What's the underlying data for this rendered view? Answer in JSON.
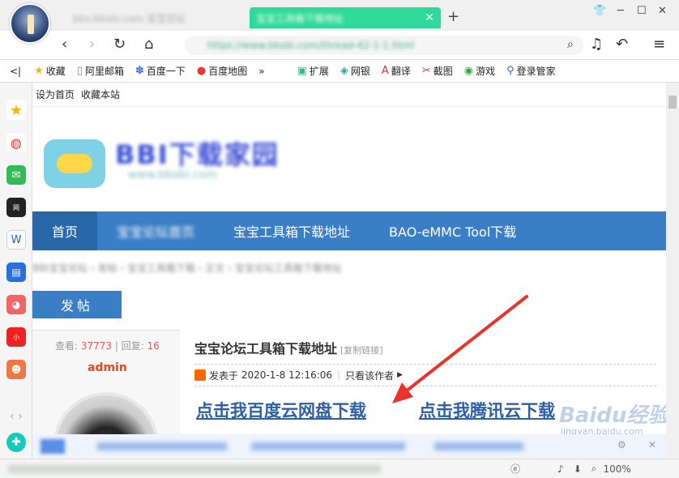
{
  "browser": {
    "tabs": [
      {
        "label": "bbs.bbsbi.com 宝宝论坛"
      },
      {
        "label": "宝宝工具箱下载地址"
      }
    ],
    "url": "https://www.bbsbi.com/thread-42-1-1.html",
    "new_tab": "+",
    "zoom": "100%"
  },
  "bookmarks": [
    {
      "label": "收藏",
      "icon": "star-icon"
    },
    {
      "label": "阿里邮箱",
      "icon": "page-icon"
    },
    {
      "label": "百度一下",
      "icon": "paw-icon"
    },
    {
      "label": "百度地图",
      "icon": "pin-icon"
    },
    {
      "label": "扩展",
      "icon": "puzzle-icon"
    },
    {
      "label": "网银",
      "icon": "shield-icon"
    },
    {
      "label": "翻译",
      "icon": "translate-icon"
    },
    {
      "label": "截图",
      "icon": "scissors-icon"
    },
    {
      "label": "游戏",
      "icon": "gamepad-icon"
    },
    {
      "label": "登录管家",
      "icon": "key-icon"
    }
  ],
  "site": {
    "topline": [
      "设为首页",
      "收藏本站"
    ],
    "logo_text": "BBI下载家园",
    "logo_sub": "www.bbsbi.com",
    "menu": [
      "首页",
      "宝宝论坛首页",
      "宝宝工具箱下载地址",
      "BAO-eMMC Tool下载"
    ],
    "crumbs": "BBI宝宝论坛 › 发帖 › 宝宝工具箱下载 › 正文 › 宝宝论坛工具箱下载地址",
    "post_button": "发帖"
  },
  "post": {
    "views_label": "查看:",
    "views": "37773",
    "replies_label": "| 回复:",
    "replies": "16",
    "author": "admin",
    "title": "宝宝论坛工具箱下载地址",
    "copy_link": "[复制链接]",
    "posted_label": "发表于",
    "posted_time": "2020-1-8 12:16:06",
    "only_author": "只看该作者",
    "download_baidu": "点击我百度云网盘下载",
    "download_tencent": "点击我腾讯云下载"
  },
  "watermark": {
    "main": "Baidu经验",
    "sub": "jingyan.baidu.com"
  },
  "colors": {
    "menu": "#3a7ec6",
    "tab_active": "#2ed99b",
    "link": "#2e5fa3",
    "arrow": "#e8352c"
  }
}
